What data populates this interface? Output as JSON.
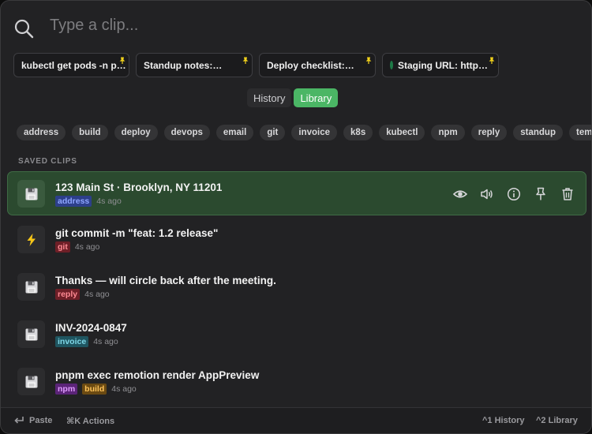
{
  "search": {
    "placeholder": "Type a clip..."
  },
  "pinned": [
    {
      "label": "kubectl get pods -n p…",
      "has_globe": false
    },
    {
      "label": "Standup notes:…",
      "has_globe": false
    },
    {
      "label": "Deploy checklist:…",
      "has_globe": false
    },
    {
      "label": "Staging URL: http…",
      "has_globe": true
    }
  ],
  "tabs": [
    {
      "label": "History",
      "active": false
    },
    {
      "label": "Library",
      "active": true
    }
  ],
  "tags": [
    "address",
    "build",
    "deploy",
    "devops",
    "email",
    "git",
    "invoice",
    "k8s",
    "kubectl",
    "npm",
    "reply",
    "standup",
    "template"
  ],
  "section_label": "SAVED CLIPS",
  "clips": [
    {
      "title": "123 Main St · Brooklyn, NY 11201",
      "icon": "floppy-disk-icon",
      "tags": [
        {
          "label": "address",
          "bg": "#2d3f8a",
          "fg": "#8fa6ff"
        }
      ],
      "time": "4s ago",
      "selected": true
    },
    {
      "title": "git commit -m \"feat: 1.2 release\"",
      "icon": "lightning-icon",
      "tags": [
        {
          "label": "git",
          "bg": "#6e1f27",
          "fg": "#ff8a93"
        }
      ],
      "time": "4s ago",
      "selected": false
    },
    {
      "title": "Thanks — will circle back after the meeting.",
      "icon": "floppy-disk-icon",
      "tags": [
        {
          "label": "reply",
          "bg": "#6e1f27",
          "fg": "#ff8a93"
        }
      ],
      "time": "4s ago",
      "selected": false
    },
    {
      "title": "INV-2024-0847",
      "icon": "floppy-disk-icon",
      "tags": [
        {
          "label": "invoice",
          "bg": "#1f5560",
          "fg": "#7fd8e8"
        }
      ],
      "time": "4s ago",
      "selected": false
    },
    {
      "title": "pnpm exec remotion render AppPreview",
      "icon": "floppy-disk-icon",
      "tags": [
        {
          "label": "npm",
          "bg": "#5b2478",
          "fg": "#e09bff"
        },
        {
          "label": "build",
          "bg": "#6b4a12",
          "fg": "#ffc35a"
        }
      ],
      "time": "4s ago",
      "selected": false
    }
  ],
  "row_actions": [
    "eye-icon",
    "speaker-icon",
    "info-icon",
    "pin-icon",
    "trash-icon"
  ],
  "footer": {
    "paste": "Paste",
    "actions": "⌘K Actions",
    "history": "^1 History",
    "library": "^2 Library"
  },
  "colors": {
    "accent": "#4bb665",
    "pin": "#f2d21b"
  }
}
